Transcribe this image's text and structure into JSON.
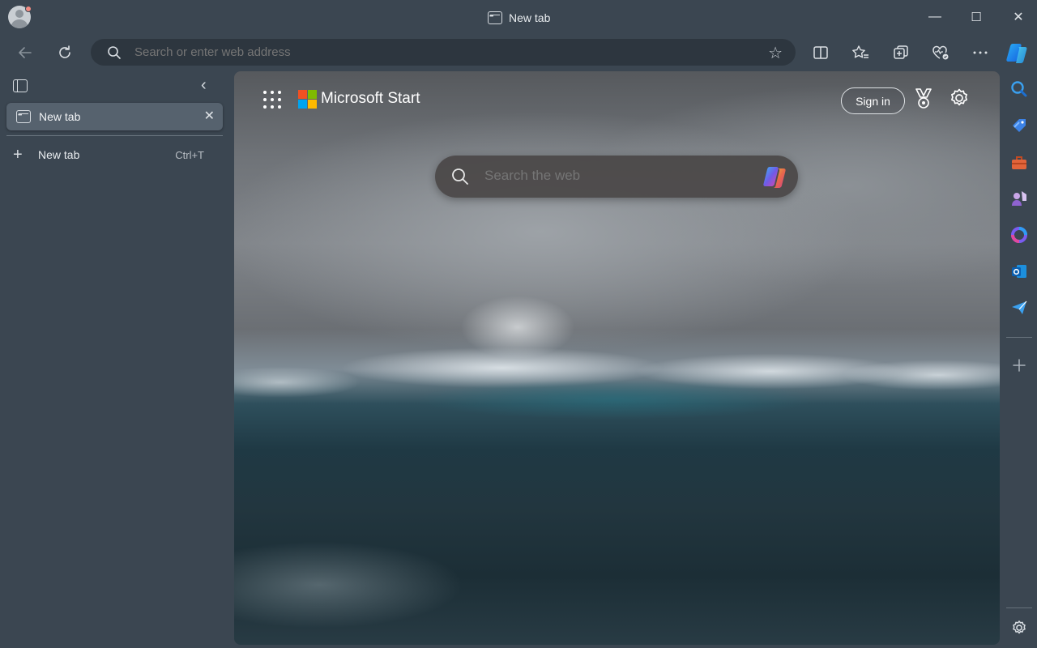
{
  "window": {
    "title": "New tab",
    "minimize_glyph": "—",
    "maximize_glyph": "☐",
    "close_glyph": "✕"
  },
  "toolbar": {
    "address_placeholder": "Search or enter web address",
    "icons": [
      "back-icon",
      "refresh-icon",
      "search-icon",
      "favorite-star-icon",
      "split-screen-icon",
      "favorites-icon",
      "collections-icon",
      "browser-essentials-icon",
      "more-icon",
      "copilot-icon"
    ]
  },
  "sidebar": {
    "tabs": [
      {
        "label": "New tab",
        "active": true
      }
    ],
    "new_tab_label": "New tab",
    "new_tab_shortcut": "Ctrl+T"
  },
  "newtab": {
    "brand": "Microsoft Start",
    "sign_in": "Sign in",
    "search_placeholder": "Search the web",
    "logo_colors": [
      "#f25022",
      "#7fba00",
      "#00a4ef",
      "#ffb900"
    ]
  },
  "right_sidebar": {
    "icons": [
      "search-icon",
      "shopping-tag-icon",
      "tools-icon",
      "games-icon",
      "copilot-icon",
      "outlook-icon",
      "drop-icon",
      "add-icon",
      "settings-icon"
    ]
  },
  "colors": {
    "frame": "#3b4651",
    "address_bar": "#2d363f",
    "active_tab": "#56626e"
  }
}
